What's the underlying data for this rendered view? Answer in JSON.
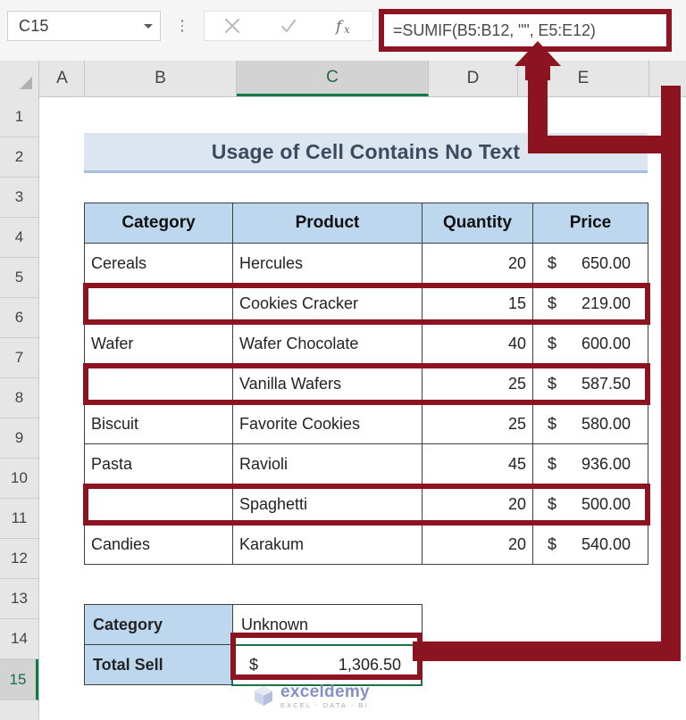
{
  "formula_bar": {
    "name_box_value": "C15",
    "cancel_icon": "close-icon",
    "enter_icon": "check-icon",
    "function_icon": "fx-icon",
    "formula": "=SUMIF(B5:B12, \"\", E5:E12)"
  },
  "grid": {
    "columns": [
      "A",
      "B",
      "C",
      "D",
      "E"
    ],
    "selected_column": "C",
    "rows": [
      "1",
      "2",
      "3",
      "4",
      "5",
      "6",
      "7",
      "8",
      "9",
      "10",
      "11",
      "12",
      "13",
      "14",
      "15"
    ],
    "selected_row": "15"
  },
  "banner": {
    "title": "Usage of Cell Contains No Text"
  },
  "table": {
    "headers": [
      "Category",
      "Product",
      "Quantity",
      "Price"
    ],
    "rows": [
      {
        "category": "Cereals",
        "product": "Hercules",
        "quantity": "20",
        "currency": "$",
        "price": "650.00",
        "highlight": false
      },
      {
        "category": "",
        "product": "Cookies Cracker",
        "quantity": "15",
        "currency": "$",
        "price": "219.00",
        "highlight": true
      },
      {
        "category": "Wafer",
        "product": "Wafer Chocolate",
        "quantity": "40",
        "currency": "$",
        "price": "600.00",
        "highlight": false
      },
      {
        "category": "",
        "product": "Vanilla Wafers",
        "quantity": "25",
        "currency": "$",
        "price": "587.50",
        "highlight": true
      },
      {
        "category": "Biscuit",
        "product": "Favorite Cookies",
        "quantity": "25",
        "currency": "$",
        "price": "580.00",
        "highlight": false
      },
      {
        "category": "Pasta",
        "product": "Ravioli",
        "quantity": "45",
        "currency": "$",
        "price": "936.00",
        "highlight": false
      },
      {
        "category": "",
        "product": "Spaghetti",
        "quantity": "20",
        "currency": "$",
        "price": "500.00",
        "highlight": true
      },
      {
        "category": "Candies",
        "product": "Karakum",
        "quantity": "20",
        "currency": "$",
        "price": "540.00",
        "highlight": false
      }
    ]
  },
  "summary": {
    "category_label": "Category",
    "category_value": "Unknown",
    "total_label": "Total Sell",
    "total_currency": "$",
    "total_value": "1,306.50"
  },
  "annotation": {
    "color": "#8b1420",
    "arrow": "up-arrow-callout"
  },
  "watermark": {
    "name": "exceldemy",
    "subtitle": "EXCEL - DATA - BI"
  },
  "colors": {
    "accent_red": "#8b1420",
    "header_blue": "#bdd7ee",
    "banner_blue": "#dce6f1",
    "selection_green": "#1e7145"
  }
}
